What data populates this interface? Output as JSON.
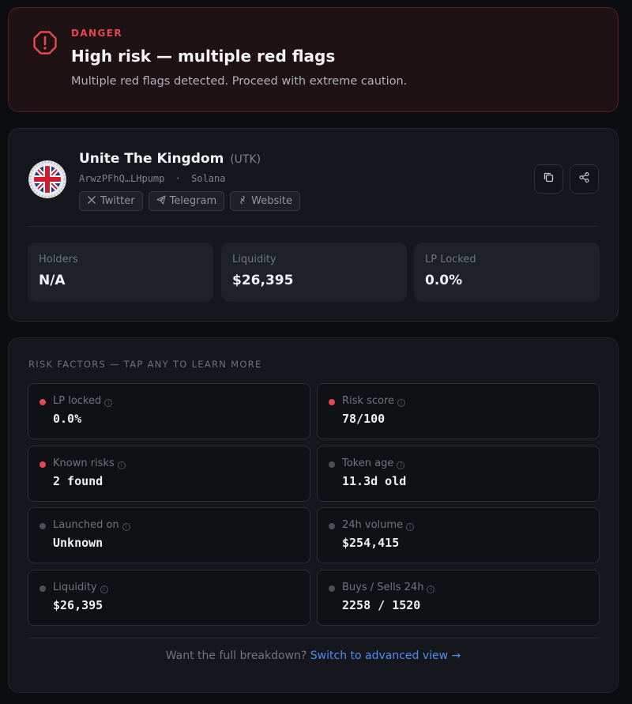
{
  "banner": {
    "tag": "DANGER",
    "title": "High risk — multiple red flags",
    "description": "Multiple red flags detected. Proceed with extreme caution.",
    "color": "#e5484d"
  },
  "token": {
    "name": "Unite The Kingdom",
    "symbol": "(UTK)",
    "address": "ArwzPFhQ…LHpump",
    "chain_separator": "·",
    "chain": "Solana",
    "links": [
      {
        "label": "Twitter",
        "icon": "x-icon"
      },
      {
        "label": "Telegram",
        "icon": "telegram-icon"
      },
      {
        "label": "Website",
        "icon": "globe-icon"
      }
    ],
    "actions": [
      {
        "label": "copy",
        "icon": "copy-icon"
      },
      {
        "label": "share",
        "icon": "share-icon"
      }
    ],
    "stats": [
      {
        "label": "Holders",
        "value": "N/A"
      },
      {
        "label": "Liquidity",
        "value": "$26,395"
      },
      {
        "label": "LP Locked",
        "value": "0.0%"
      }
    ]
  },
  "risk": {
    "heading": "RISK FACTORS — TAP ANY TO LEARN MORE",
    "factors": [
      {
        "label": "LP locked",
        "value": "0.0%",
        "status": "danger"
      },
      {
        "label": "Risk score",
        "value": "78/100",
        "status": "danger"
      },
      {
        "label": "Known risks",
        "value": "2 found",
        "status": "danger"
      },
      {
        "label": "Token age",
        "value": "11.3d old",
        "status": "neutral"
      },
      {
        "label": "Launched on",
        "value": "Unknown",
        "status": "neutral"
      },
      {
        "label": "24h volume",
        "value": "$254,415",
        "status": "neutral"
      },
      {
        "label": "Liquidity",
        "value": "$26,395",
        "status": "neutral"
      },
      {
        "label": "Buys / Sells 24h",
        "value": "2258 / 1520",
        "status": "neutral"
      }
    ],
    "footer_text": "Want the full breakdown?",
    "footer_link": "Switch to advanced view →",
    "colors": {
      "danger": "#e5484d",
      "neutral": "#4a4f59",
      "link": "#4b8ef5"
    }
  }
}
